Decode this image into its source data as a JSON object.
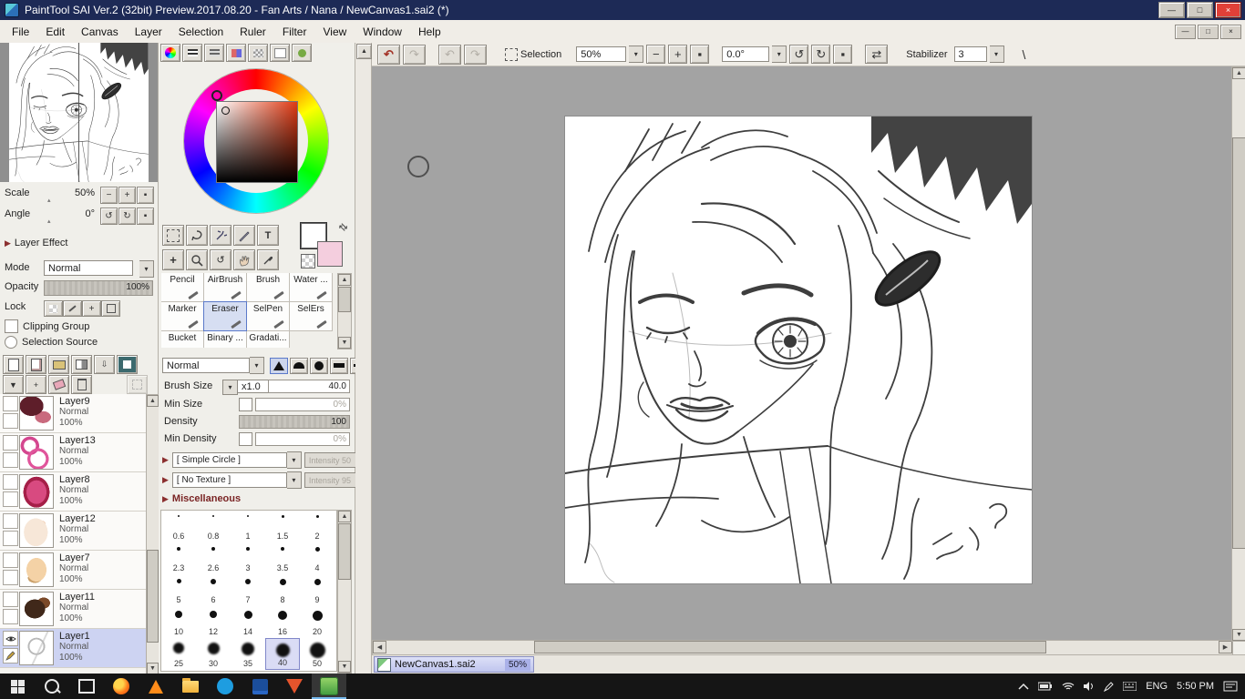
{
  "glyphs": {
    "minus": "−",
    "plus": "+",
    "square": "▪",
    "undo": "↶",
    "redo": "↷",
    "rot_ccw": "↺",
    "rot_cw": "↻",
    "swap": "⇄",
    "dd": "▾",
    "up": "▲",
    "down": "▼",
    "left": "◀",
    "right": "▶",
    "close": "×",
    "minimize": "—",
    "maximize": "□",
    "text_tool": "T",
    "backslash": "\\",
    "caret": "▴",
    "expand": "▶"
  },
  "window": {
    "title": "PaintTool SAI Ver.2 (32bit) Preview.2017.08.20 - Fan Arts / Nana / NewCanvas1.sai2 (*)"
  },
  "menu": {
    "items": [
      "File",
      "Edit",
      "Canvas",
      "Layer",
      "Selection",
      "Ruler",
      "Filter",
      "View",
      "Window",
      "Help"
    ]
  },
  "toolbar": {
    "selection_label": "Selection",
    "zoom_value": "50%",
    "angle_value": "0.0°",
    "stabilizer_label": "Stabilizer",
    "stabilizer_value": "3"
  },
  "navigator": {
    "scale_label": "Scale",
    "scale_value": "50%",
    "angle_label": "Angle",
    "angle_value": "0°"
  },
  "layer_panel": {
    "effect_header": "Layer Effect",
    "mode_label": "Mode",
    "mode_value": "Normal",
    "opacity_label": "Opacity",
    "opacity_value": "100%",
    "lock_label": "Lock",
    "clipping_label": "Clipping Group",
    "selection_source_label": "Selection Source",
    "layers": [
      {
        "name": "Layer9",
        "mode": "Normal",
        "opacity": "100%",
        "thumb": "th-l9",
        "selected": false
      },
      {
        "name": "Layer13",
        "mode": "Normal",
        "opacity": "100%",
        "thumb": "th-l13",
        "selected": false
      },
      {
        "name": "Layer8",
        "mode": "Normal",
        "opacity": "100%",
        "thumb": "th-l8",
        "selected": false
      },
      {
        "name": "Layer12",
        "mode": "Normal",
        "opacity": "100%",
        "thumb": "th-l12",
        "selected": false
      },
      {
        "name": "Layer7",
        "mode": "Normal",
        "opacity": "100%",
        "thumb": "th-l7",
        "selected": false
      },
      {
        "name": "Layer11",
        "mode": "Normal",
        "opacity": "100%",
        "thumb": "th-l11",
        "selected": false
      },
      {
        "name": "Layer1",
        "mode": "Normal",
        "opacity": "100%",
        "thumb": "th-l1",
        "selected": true
      }
    ]
  },
  "tools": {
    "items": [
      "Pencil",
      "AirBrush",
      "Brush",
      "Water ...",
      "Marker",
      "Eraser",
      "SelPen",
      "SelErs",
      "Bucket",
      "Binary ...",
      "Gradati..."
    ],
    "selected": "Eraser"
  },
  "brush": {
    "blend_value": "Normal",
    "size_label": "Brush Size",
    "size_unit": "x1.0",
    "size_value": "40.0",
    "min_size_label": "Min Size",
    "min_size_value": "0%",
    "density_label": "Density",
    "density_value": "100",
    "min_density_label": "Min Density",
    "min_density_value": "0%",
    "shape_value": "[ Simple Circle ]",
    "shape_intensity": "Intensity 50",
    "texture_value": "[ No Texture ]",
    "texture_intensity": "Intensity 95",
    "misc_header": "Miscellaneous",
    "sizes": [
      "0.6",
      "0.8",
      "1",
      "1.5",
      "2",
      "2.3",
      "2.6",
      "3",
      "3.5",
      "4",
      "5",
      "6",
      "7",
      "8",
      "9",
      "10",
      "12",
      "14",
      "16",
      "20",
      "25",
      "30",
      "35",
      "40",
      "50"
    ],
    "selected_size": "40"
  },
  "doc_tab": {
    "name": "NewCanvas1.sai2",
    "zoom": "50%"
  },
  "taskbar": {
    "language": "ENG",
    "time": "5:50 PM"
  }
}
